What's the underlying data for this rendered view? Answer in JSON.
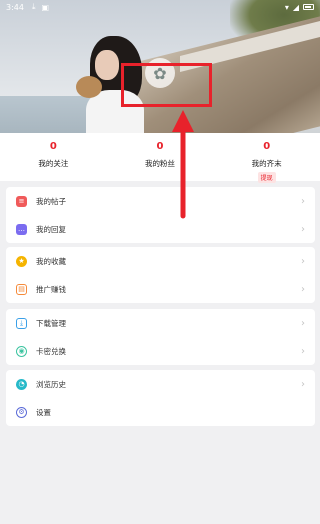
{
  "status": {
    "time": "3:44",
    "icons": [
      "download-icon",
      "image-icon"
    ],
    "right_icons": [
      "wifi-icon",
      "signal-icon",
      "battery-icon"
    ]
  },
  "profile": {
    "avatar": "avatar-icon"
  },
  "stats": [
    {
      "value": "0",
      "label": "我的关注"
    },
    {
      "value": "0",
      "label": "我的粉丝"
    },
    {
      "value": "0",
      "label": "我的齐末",
      "badge": "提现"
    }
  ],
  "groups": [
    [
      {
        "label": "我的帖子",
        "icon": "post-icon",
        "color": "#f05a5a"
      },
      {
        "label": "我的回复",
        "icon": "reply-icon",
        "color": "#7b6cf0"
      }
    ],
    [
      {
        "label": "我的收藏",
        "icon": "star-icon",
        "color": "#f5b400"
      },
      {
        "label": "推广赚钱",
        "icon": "gift-icon",
        "color": "#f58a3a"
      }
    ],
    [
      {
        "label": "下载管理",
        "icon": "download-manage-icon",
        "color": "#3aa0e8"
      },
      {
        "label": "卡密兑换",
        "icon": "redeem-icon",
        "color": "#3cc4a0"
      }
    ],
    [
      {
        "label": "浏览历史",
        "icon": "history-icon",
        "color": "#26b9c9"
      },
      {
        "label": "设置",
        "icon": "settings-icon",
        "color": "#5b6bd8"
      }
    ]
  ],
  "colors": {
    "accent": "#e8222b"
  }
}
